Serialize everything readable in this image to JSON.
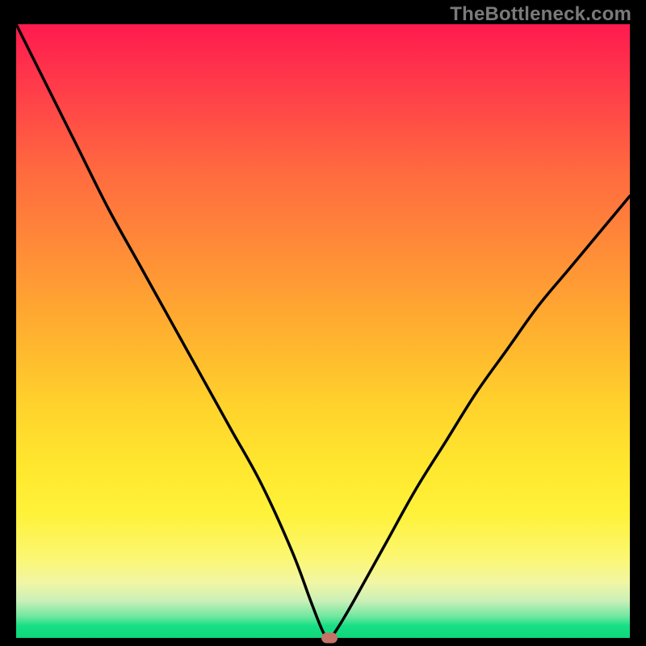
{
  "watermark": {
    "text": "TheBottleneck.com"
  },
  "colors": {
    "frame_bg": "#000000",
    "watermark": "#7a7a7a",
    "curve_stroke": "#000000",
    "marker_fill": "#c57267",
    "gradient_stops": [
      "#ff1a4e",
      "#ff3b4a",
      "#ff6a3f",
      "#ff8a38",
      "#ffb02f",
      "#ffd22c",
      "#ffe72e",
      "#fff23a",
      "#fbf773",
      "#f1f6a4",
      "#c9f0b8",
      "#70e79f",
      "#18df85",
      "#0cd879"
    ]
  },
  "chart_data": {
    "type": "line",
    "title": "",
    "xlabel": "",
    "ylabel": "",
    "xlim": [
      0,
      100
    ],
    "ylim": [
      0,
      100
    ],
    "grid": false,
    "series": [
      {
        "name": "bottleneck-curve",
        "x": [
          0,
          5,
          10,
          15,
          20,
          25,
          30,
          35,
          40,
          45,
          48,
          50,
          51,
          52,
          55,
          60,
          65,
          70,
          75,
          80,
          85,
          90,
          95,
          100
        ],
        "values": [
          100,
          90,
          80,
          70,
          61,
          52,
          43,
          34,
          25,
          14,
          6,
          1,
          0,
          1,
          6,
          15,
          24,
          32,
          40,
          47,
          54,
          60,
          66,
          72
        ]
      }
    ],
    "annotations": [
      {
        "name": "optimal-marker",
        "x": 51,
        "y": 0
      }
    ],
    "note": "Values are read off the plot visually (no labeled axes). x=0..100 spans plot width, y=0..100 spans plot height where 0 is the bottom (green) and 100 is the top (red). The minimum (optimal point) sits near x≈51."
  }
}
